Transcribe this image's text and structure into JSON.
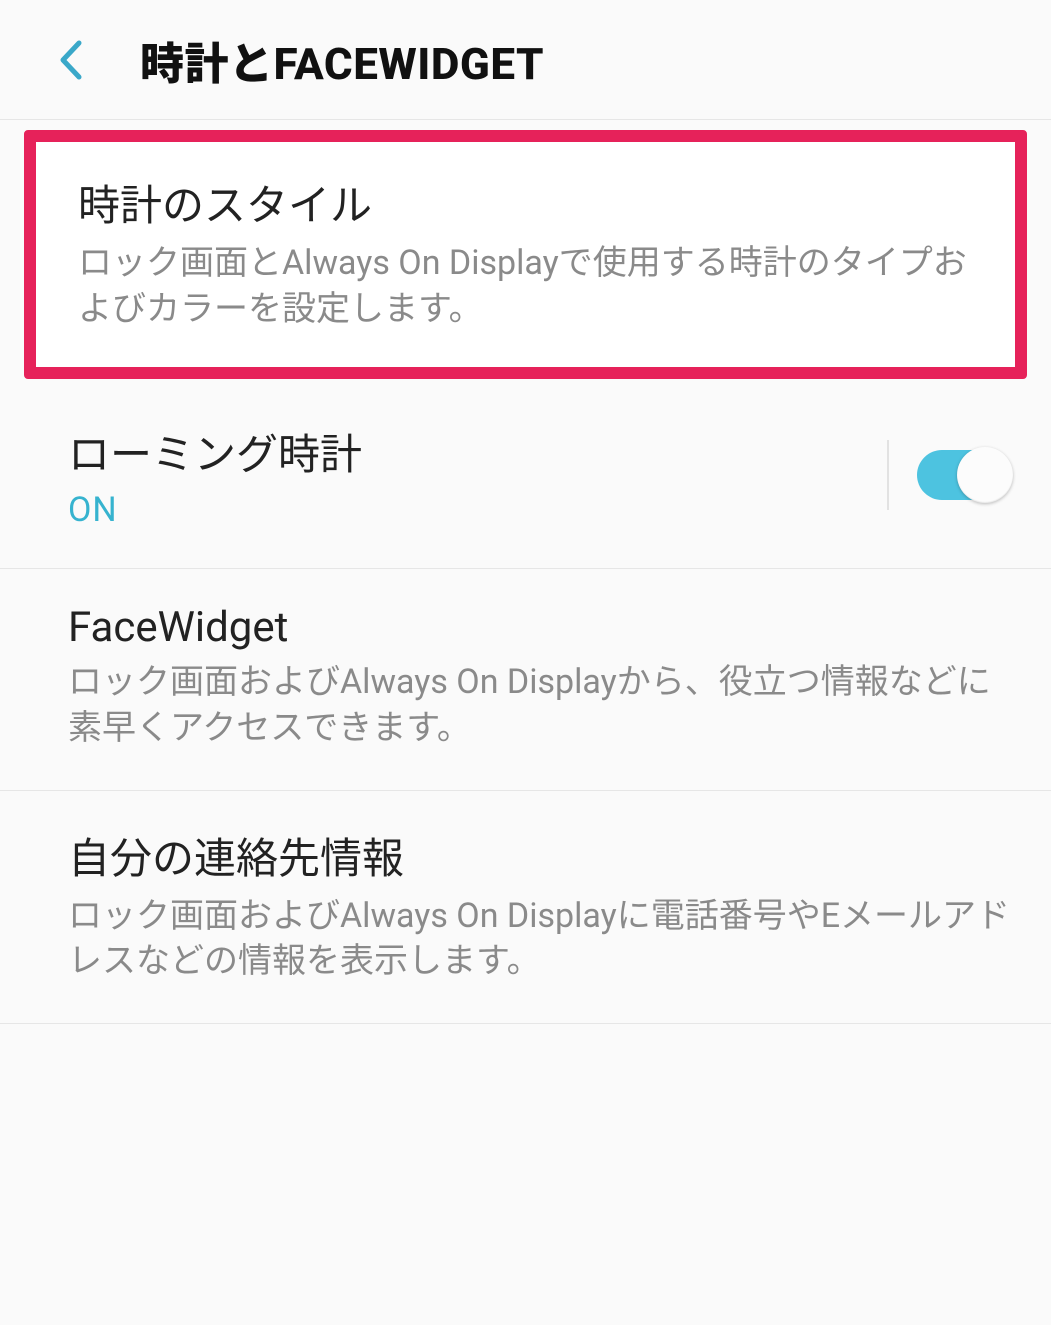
{
  "header": {
    "title": "時計とFACEWIDGET"
  },
  "items": [
    {
      "title": "時計のスタイル",
      "desc": "ロック画面とAlways On Displayで使用する時計のタイプおよびカラーを設定します。"
    },
    {
      "title": "ローミング時計",
      "status": "ON",
      "toggle": true
    },
    {
      "title": "FaceWidget",
      "desc": "ロック画面およびAlways On Displayから、役立つ情報などに素早くアクセスできます。"
    },
    {
      "title": "自分の連絡先情報",
      "desc": "ロック画面およびAlways On Displayに電話番号やEメールアドレスなどの情報を表示します。"
    }
  ]
}
